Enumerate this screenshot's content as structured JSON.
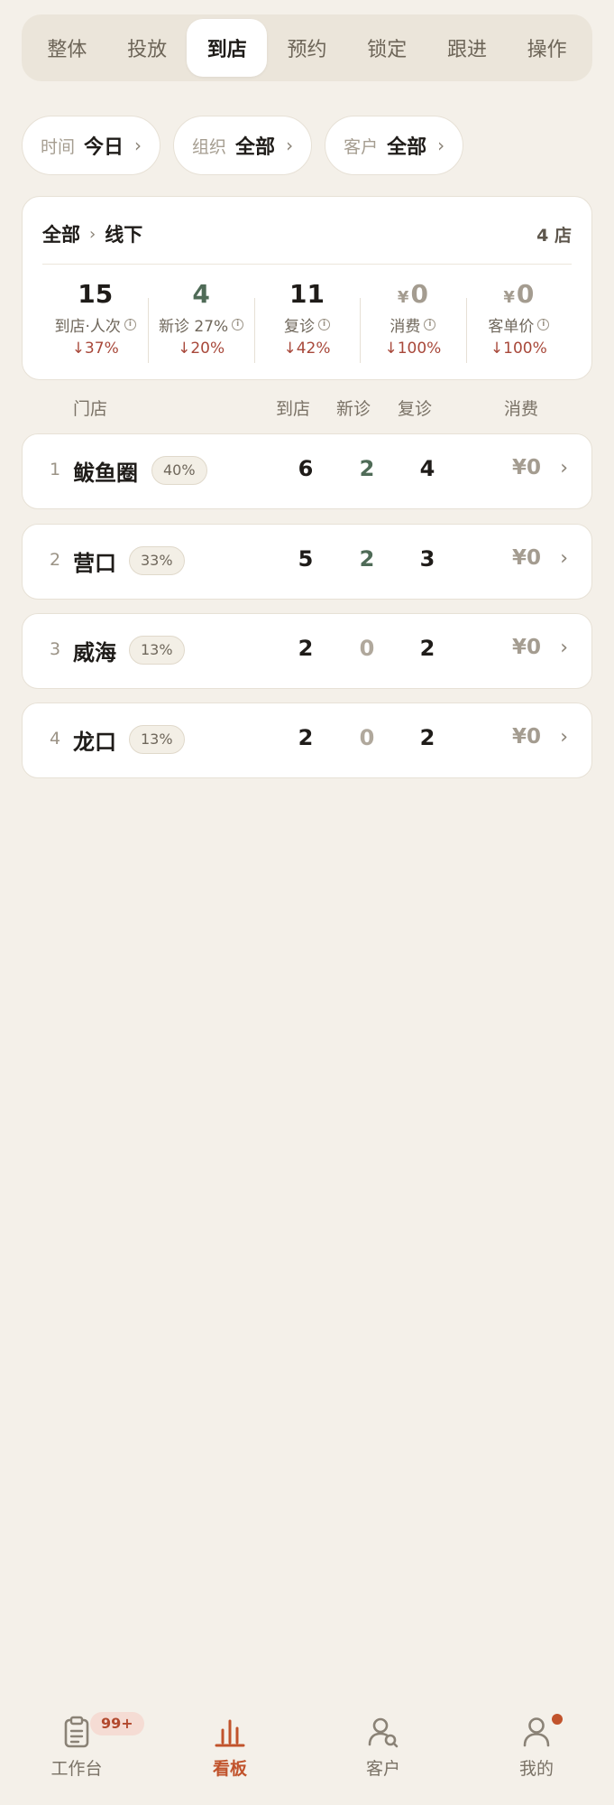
{
  "tabs": [
    {
      "label": "整体",
      "active": false
    },
    {
      "label": "投放",
      "active": false
    },
    {
      "label": "到店",
      "active": true
    },
    {
      "label": "预约",
      "active": false
    },
    {
      "label": "锁定",
      "active": false
    },
    {
      "label": "跟进",
      "active": false
    },
    {
      "label": "操作",
      "active": false
    }
  ],
  "filters": {
    "time": {
      "label": "时间",
      "value": "今日"
    },
    "org": {
      "label": "组织",
      "value": "全部"
    },
    "customer": {
      "label": "客户",
      "value": "全部"
    }
  },
  "summary": {
    "crumb_root": "全部",
    "crumb_current": "线下",
    "store_count": "4 店",
    "metrics": [
      {
        "value": "15",
        "label": "到店·人次",
        "change": "↓37%"
      },
      {
        "value": "4",
        "label": "新诊 27%",
        "change": "↓20%"
      },
      {
        "value": "11",
        "label": "复诊",
        "change": "↓42%"
      },
      {
        "currency": "¥",
        "value": "0",
        "label": "消费",
        "change": "↓100%"
      },
      {
        "currency": "¥",
        "value": "0",
        "label": "客单价",
        "change": "↓100%"
      }
    ]
  },
  "table": {
    "headers": {
      "store": "门店",
      "visits": "到店",
      "new": "新诊",
      "return": "复诊",
      "spend": "消费"
    },
    "rows": [
      {
        "rank": "1",
        "name": "鲅鱼圈",
        "share": "40%",
        "visits": "6",
        "new": "2",
        "return": "4",
        "spend": "¥0"
      },
      {
        "rank": "2",
        "name": "营口",
        "share": "33%",
        "visits": "5",
        "new": "2",
        "return": "3",
        "spend": "¥0"
      },
      {
        "rank": "3",
        "name": "威海",
        "share": "13%",
        "visits": "2",
        "new": "0",
        "return": "2",
        "spend": "¥0"
      },
      {
        "rank": "4",
        "name": "龙口",
        "share": "13%",
        "visits": "2",
        "new": "0",
        "return": "2",
        "spend": "¥0"
      }
    ]
  },
  "bottom_nav": {
    "workbench": {
      "label": "工作台",
      "badge": "99+"
    },
    "board": {
      "label": "看板"
    },
    "customers": {
      "label": "客户"
    },
    "mine": {
      "label": "我的"
    }
  },
  "colors": {
    "accent": "#c1532c",
    "positive_green": "#4f6b57",
    "decline_red": "#a8483a",
    "background": "#f4f0e9"
  }
}
